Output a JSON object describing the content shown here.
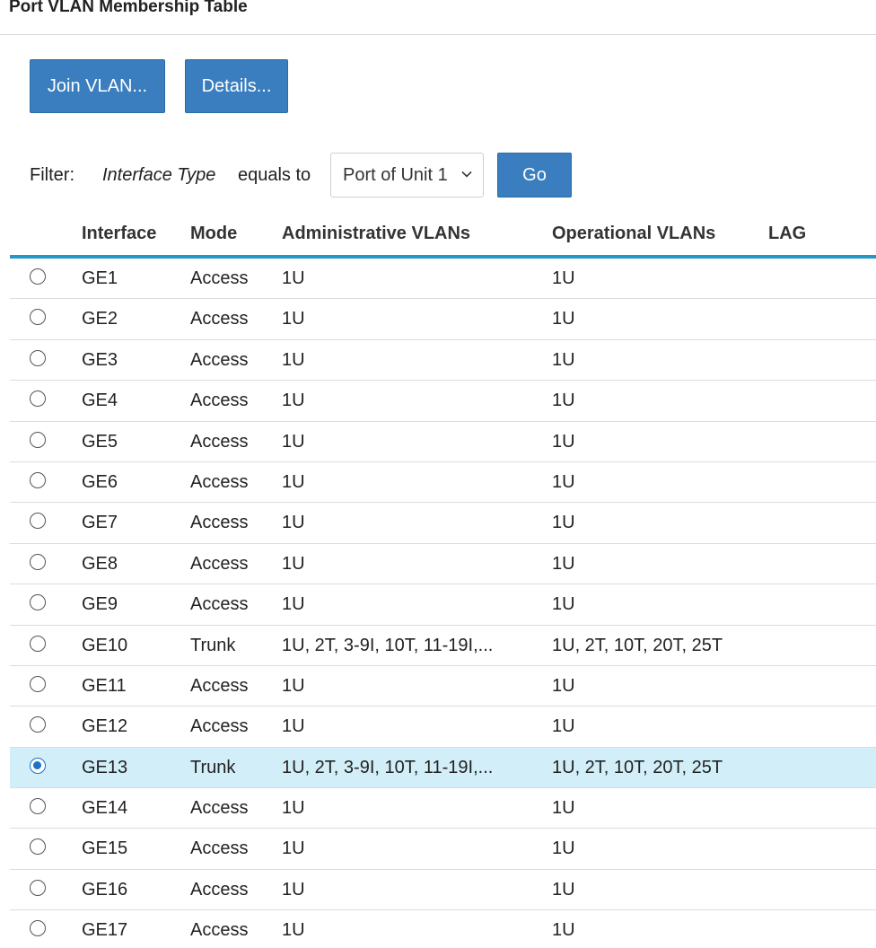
{
  "page": {
    "title": "Port VLAN Membership Table"
  },
  "toolbar": {
    "join_label": "Join VLAN...",
    "details_label": "Details..."
  },
  "filter": {
    "label": "Filter:",
    "field": "Interface Type",
    "operator": "equals to",
    "selected_value": "Port of Unit 1",
    "go_label": "Go"
  },
  "table": {
    "headers": {
      "interface": "Interface",
      "mode": "Mode",
      "admin_vlans": "Administrative VLANs",
      "oper_vlans": "Operational VLANs",
      "lag": "LAG"
    },
    "rows": [
      {
        "interface": "GE1",
        "mode": "Access",
        "admin": "1U",
        "oper": "1U",
        "lag": "",
        "selected": false
      },
      {
        "interface": "GE2",
        "mode": "Access",
        "admin": "1U",
        "oper": "1U",
        "lag": "",
        "selected": false
      },
      {
        "interface": "GE3",
        "mode": "Access",
        "admin": "1U",
        "oper": "1U",
        "lag": "",
        "selected": false
      },
      {
        "interface": "GE4",
        "mode": "Access",
        "admin": "1U",
        "oper": "1U",
        "lag": "",
        "selected": false
      },
      {
        "interface": "GE5",
        "mode": "Access",
        "admin": "1U",
        "oper": "1U",
        "lag": "",
        "selected": false
      },
      {
        "interface": "GE6",
        "mode": "Access",
        "admin": "1U",
        "oper": "1U",
        "lag": "",
        "selected": false
      },
      {
        "interface": "GE7",
        "mode": "Access",
        "admin": "1U",
        "oper": "1U",
        "lag": "",
        "selected": false
      },
      {
        "interface": "GE8",
        "mode": "Access",
        "admin": "1U",
        "oper": "1U",
        "lag": "",
        "selected": false
      },
      {
        "interface": "GE9",
        "mode": "Access",
        "admin": "1U",
        "oper": "1U",
        "lag": "",
        "selected": false
      },
      {
        "interface": "GE10",
        "mode": "Trunk",
        "admin": "1U, 2T, 3-9I, 10T, 11-19I,...",
        "oper": "1U, 2T, 10T, 20T, 25T",
        "lag": "",
        "selected": false
      },
      {
        "interface": "GE11",
        "mode": "Access",
        "admin": "1U",
        "oper": "1U",
        "lag": "",
        "selected": false
      },
      {
        "interface": "GE12",
        "mode": "Access",
        "admin": "1U",
        "oper": "1U",
        "lag": "",
        "selected": false
      },
      {
        "interface": "GE13",
        "mode": "Trunk",
        "admin": "1U, 2T, 3-9I, 10T, 11-19I,...",
        "oper": "1U, 2T, 10T, 20T, 25T",
        "lag": "",
        "selected": true
      },
      {
        "interface": "GE14",
        "mode": "Access",
        "admin": "1U",
        "oper": "1U",
        "lag": "",
        "selected": false
      },
      {
        "interface": "GE15",
        "mode": "Access",
        "admin": "1U",
        "oper": "1U",
        "lag": "",
        "selected": false
      },
      {
        "interface": "GE16",
        "mode": "Access",
        "admin": "1U",
        "oper": "1U",
        "lag": "",
        "selected": false
      },
      {
        "interface": "GE17",
        "mode": "Access",
        "admin": "1U",
        "oper": "1U",
        "lag": "",
        "selected": false
      }
    ]
  },
  "colors": {
    "button": "#3a7ebf",
    "header_rule": "#2596c8",
    "selected_row": "#d2eef8",
    "radio_checked": "#1a73c8"
  },
  "icons": {
    "select_caret": "chevron-down-icon"
  }
}
